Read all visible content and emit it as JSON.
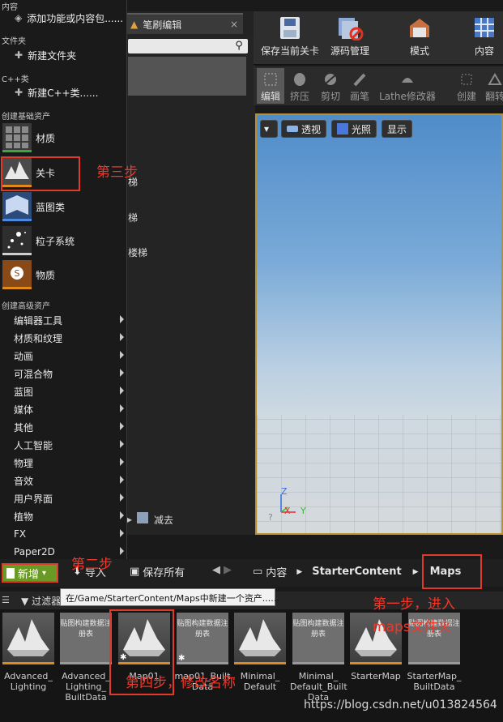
{
  "menu": {
    "sections": {
      "content": "内容",
      "folder": "文件夹",
      "cpp": "C++类",
      "basic": "创建基础资产",
      "advanced": "创建高级资产"
    },
    "add_feature": "添加功能或内容包......",
    "new_folder": "新建文件夹",
    "new_cpp": "新建C++类......",
    "basic_items": [
      {
        "label": "材质",
        "icon": "material-icon"
      },
      {
        "label": "关卡",
        "icon": "level-icon"
      },
      {
        "label": "蓝图类",
        "icon": "blueprint-icon"
      },
      {
        "label": "粒子系统",
        "icon": "particle-icon"
      },
      {
        "label": "物质",
        "icon": "substance-icon"
      }
    ],
    "advanced_items": [
      "编辑器工具",
      "材质和纹理",
      "动画",
      "可混合物",
      "蓝图",
      "媒体",
      "其他",
      "人工智能",
      "物理",
      "音效",
      "用户界面",
      "植物",
      "FX",
      "Paper2D"
    ]
  },
  "editor": {
    "pen_tab": "笔刷编辑",
    "left_fragments": [
      "梯",
      "梯",
      "楼梯"
    ],
    "subtract": "减去"
  },
  "toolbar": {
    "save_level": "保存当前关卡",
    "source_control": "源码管理",
    "modes": "模式",
    "content": "内容"
  },
  "mode_tools": {
    "edit": "编辑",
    "extrude": "挤压",
    "clip": "剪切",
    "pen": "画笔",
    "lathe": "Lathe修改器",
    "create": "创建",
    "flip": "翻转"
  },
  "viewport": {
    "perspective": "透视",
    "lit": "光照",
    "show": "显示",
    "axis_z": "Z",
    "axis_x": "X",
    "axis_y": "Y"
  },
  "content_browser": {
    "new": "新增",
    "import": "导入",
    "save_all": "保存所有",
    "path": [
      "内容",
      "StarterContent",
      "Maps"
    ],
    "tooltip": "在/Game/StarterContent/Maps中新建一个资产......",
    "filter": "过滤器",
    "data_tile_text": "贴图构建数据注册表",
    "assets": [
      {
        "label": "Advanced_ Lighting",
        "kind": "map"
      },
      {
        "label": "Advanced_ Lighting_ BuiltData",
        "kind": "data"
      },
      {
        "label": "Map01",
        "kind": "map"
      },
      {
        "label": "map01_Built Data",
        "kind": "data"
      },
      {
        "label": "Minimal_ Default",
        "kind": "map"
      },
      {
        "label": "Minimal_ Default_Built Data",
        "kind": "data"
      },
      {
        "label": "StarterMap",
        "kind": "map"
      },
      {
        "label": "StarterMap_ BuiltData",
        "kind": "data"
      }
    ]
  },
  "annotations": {
    "step1": "第一步，进入maps文件夹",
    "step2": "第二步",
    "step3": "第三步",
    "step4": "第四步，修改名称"
  },
  "watermark": "https://blog.csdn.net/u013824564",
  "colors": {
    "annotation": "#e23a2a",
    "new_button": "#6a9a26",
    "viewport_border": "#b8902e"
  }
}
